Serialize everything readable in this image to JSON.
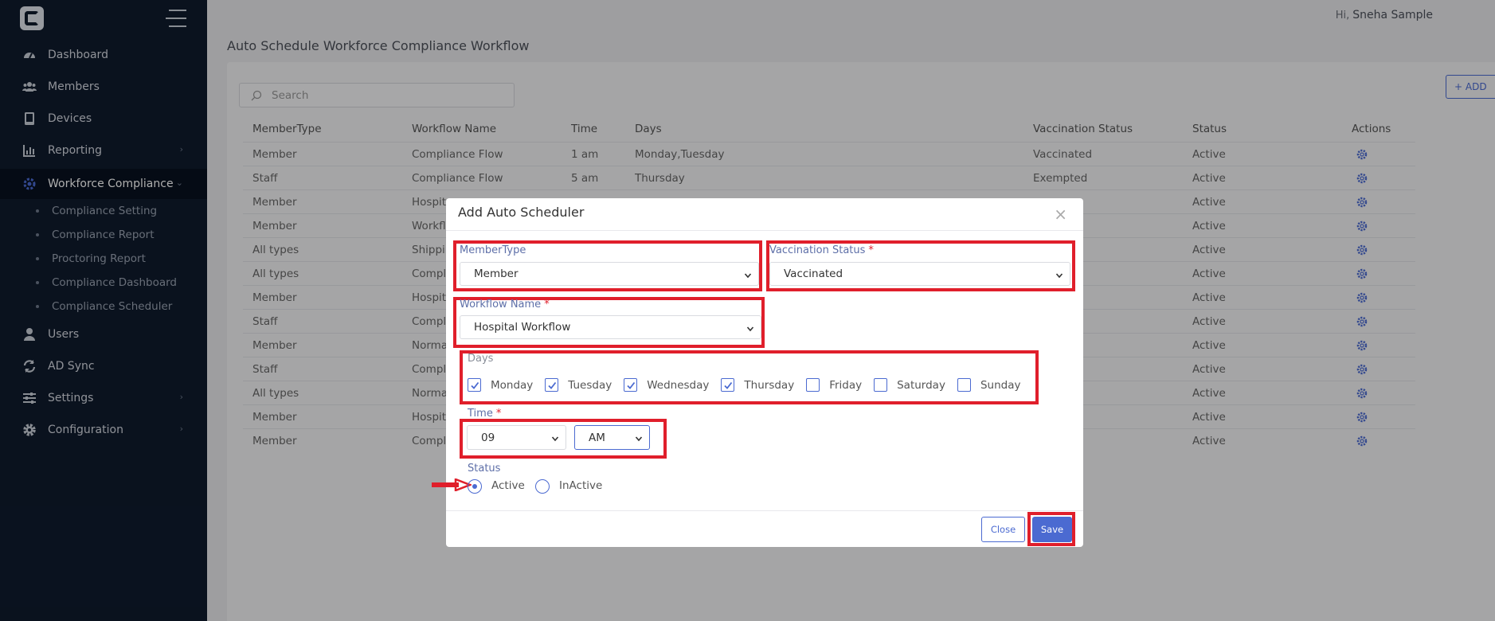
{
  "topbar": {
    "greeting_prefix": "Hi,",
    "user_name": "Sneha Sample"
  },
  "sidebar": {
    "items": [
      {
        "label": "Dashboard",
        "icon": "dashboard-icon"
      },
      {
        "label": "Members",
        "icon": "users-icon"
      },
      {
        "label": "Devices",
        "icon": "tablet-icon"
      },
      {
        "label": "Reporting",
        "icon": "chart-icon",
        "has_chevron": true
      },
      {
        "label": "Workforce Compliance",
        "icon": "gear-cog-icon",
        "active": true,
        "expanded": true
      },
      {
        "label": "Users",
        "icon": "user-icon"
      },
      {
        "label": "AD Sync",
        "icon": "sync-icon"
      },
      {
        "label": "Settings",
        "icon": "sliders-icon",
        "has_chevron": true
      },
      {
        "label": "Configuration",
        "icon": "gear-icon",
        "has_chevron": true
      }
    ],
    "subitems": [
      "Compliance Setting",
      "Compliance Report",
      "Proctoring Report",
      "Compliance Dashboard",
      "Compliance Scheduler"
    ]
  },
  "page": {
    "title": "Auto Schedule Workforce Compliance Workflow",
    "search_placeholder": "Search",
    "add_label": "+ ADD"
  },
  "table": {
    "headers": [
      "MemberType",
      "Workflow Name",
      "Time",
      "Days",
      "Vaccination Status",
      "Status",
      "Actions"
    ],
    "rows": [
      [
        "Member",
        "Compliance Flow",
        "1 am",
        "Monday,Tuesday",
        "Vaccinated",
        "Active"
      ],
      [
        "Staff",
        "Compliance Flow",
        "5 am",
        "Thursday",
        "Exempted",
        "Active"
      ],
      [
        "Member",
        "Hospit",
        "",
        "",
        "",
        "Active"
      ],
      [
        "Member",
        "Workfl",
        "",
        "",
        "ed",
        "Active"
      ],
      [
        "All types",
        "Shippin",
        "",
        "",
        "",
        "Active"
      ],
      [
        "All types",
        "Compl",
        "",
        "",
        "ated",
        "Active"
      ],
      [
        "Member",
        "Hospit",
        "",
        "",
        "ed",
        "Active"
      ],
      [
        "Staff",
        "Compl",
        "",
        "",
        "ed",
        "Active"
      ],
      [
        "Member",
        "Norma",
        "",
        "",
        "ated",
        "Active"
      ],
      [
        "Staff",
        "Compl",
        "",
        "",
        "",
        "Active"
      ],
      [
        "All types",
        "Norma",
        "",
        "",
        "",
        "Active"
      ],
      [
        "Member",
        "Hospit",
        "",
        "",
        "ed",
        "Active"
      ],
      [
        "Member",
        "Compl",
        "",
        "",
        "",
        "Active"
      ]
    ]
  },
  "modal": {
    "title": "Add Auto Scheduler",
    "member_type": {
      "label": "MemberType",
      "value": "Member"
    },
    "vaccination_status": {
      "label": "Vaccination Status",
      "required": "*",
      "value": "Vaccinated"
    },
    "workflow_name": {
      "label": "Workflow Name",
      "required": "*",
      "value": "Hospital Workflow"
    },
    "days": {
      "label": "Days",
      "options": [
        {
          "label": "Monday",
          "checked": true
        },
        {
          "label": "Tuesday",
          "checked": true
        },
        {
          "label": "Wednesday",
          "checked": true
        },
        {
          "label": "Thursday",
          "checked": true
        },
        {
          "label": "Friday",
          "checked": false
        },
        {
          "label": "Saturday",
          "checked": false
        },
        {
          "label": "Sunday",
          "checked": false
        }
      ]
    },
    "time": {
      "label": "Time",
      "required": "*",
      "hour": "09",
      "period": "AM"
    },
    "status": {
      "label": "Status",
      "active_label": "Active",
      "inactive_label": "InActive",
      "selected": "Active"
    },
    "close_label": "Close",
    "save_label": "Save"
  },
  "colors": {
    "sidebar": "#0f1b2d",
    "accent": "#4b6ad1",
    "highlight": "#e01f2b"
  }
}
